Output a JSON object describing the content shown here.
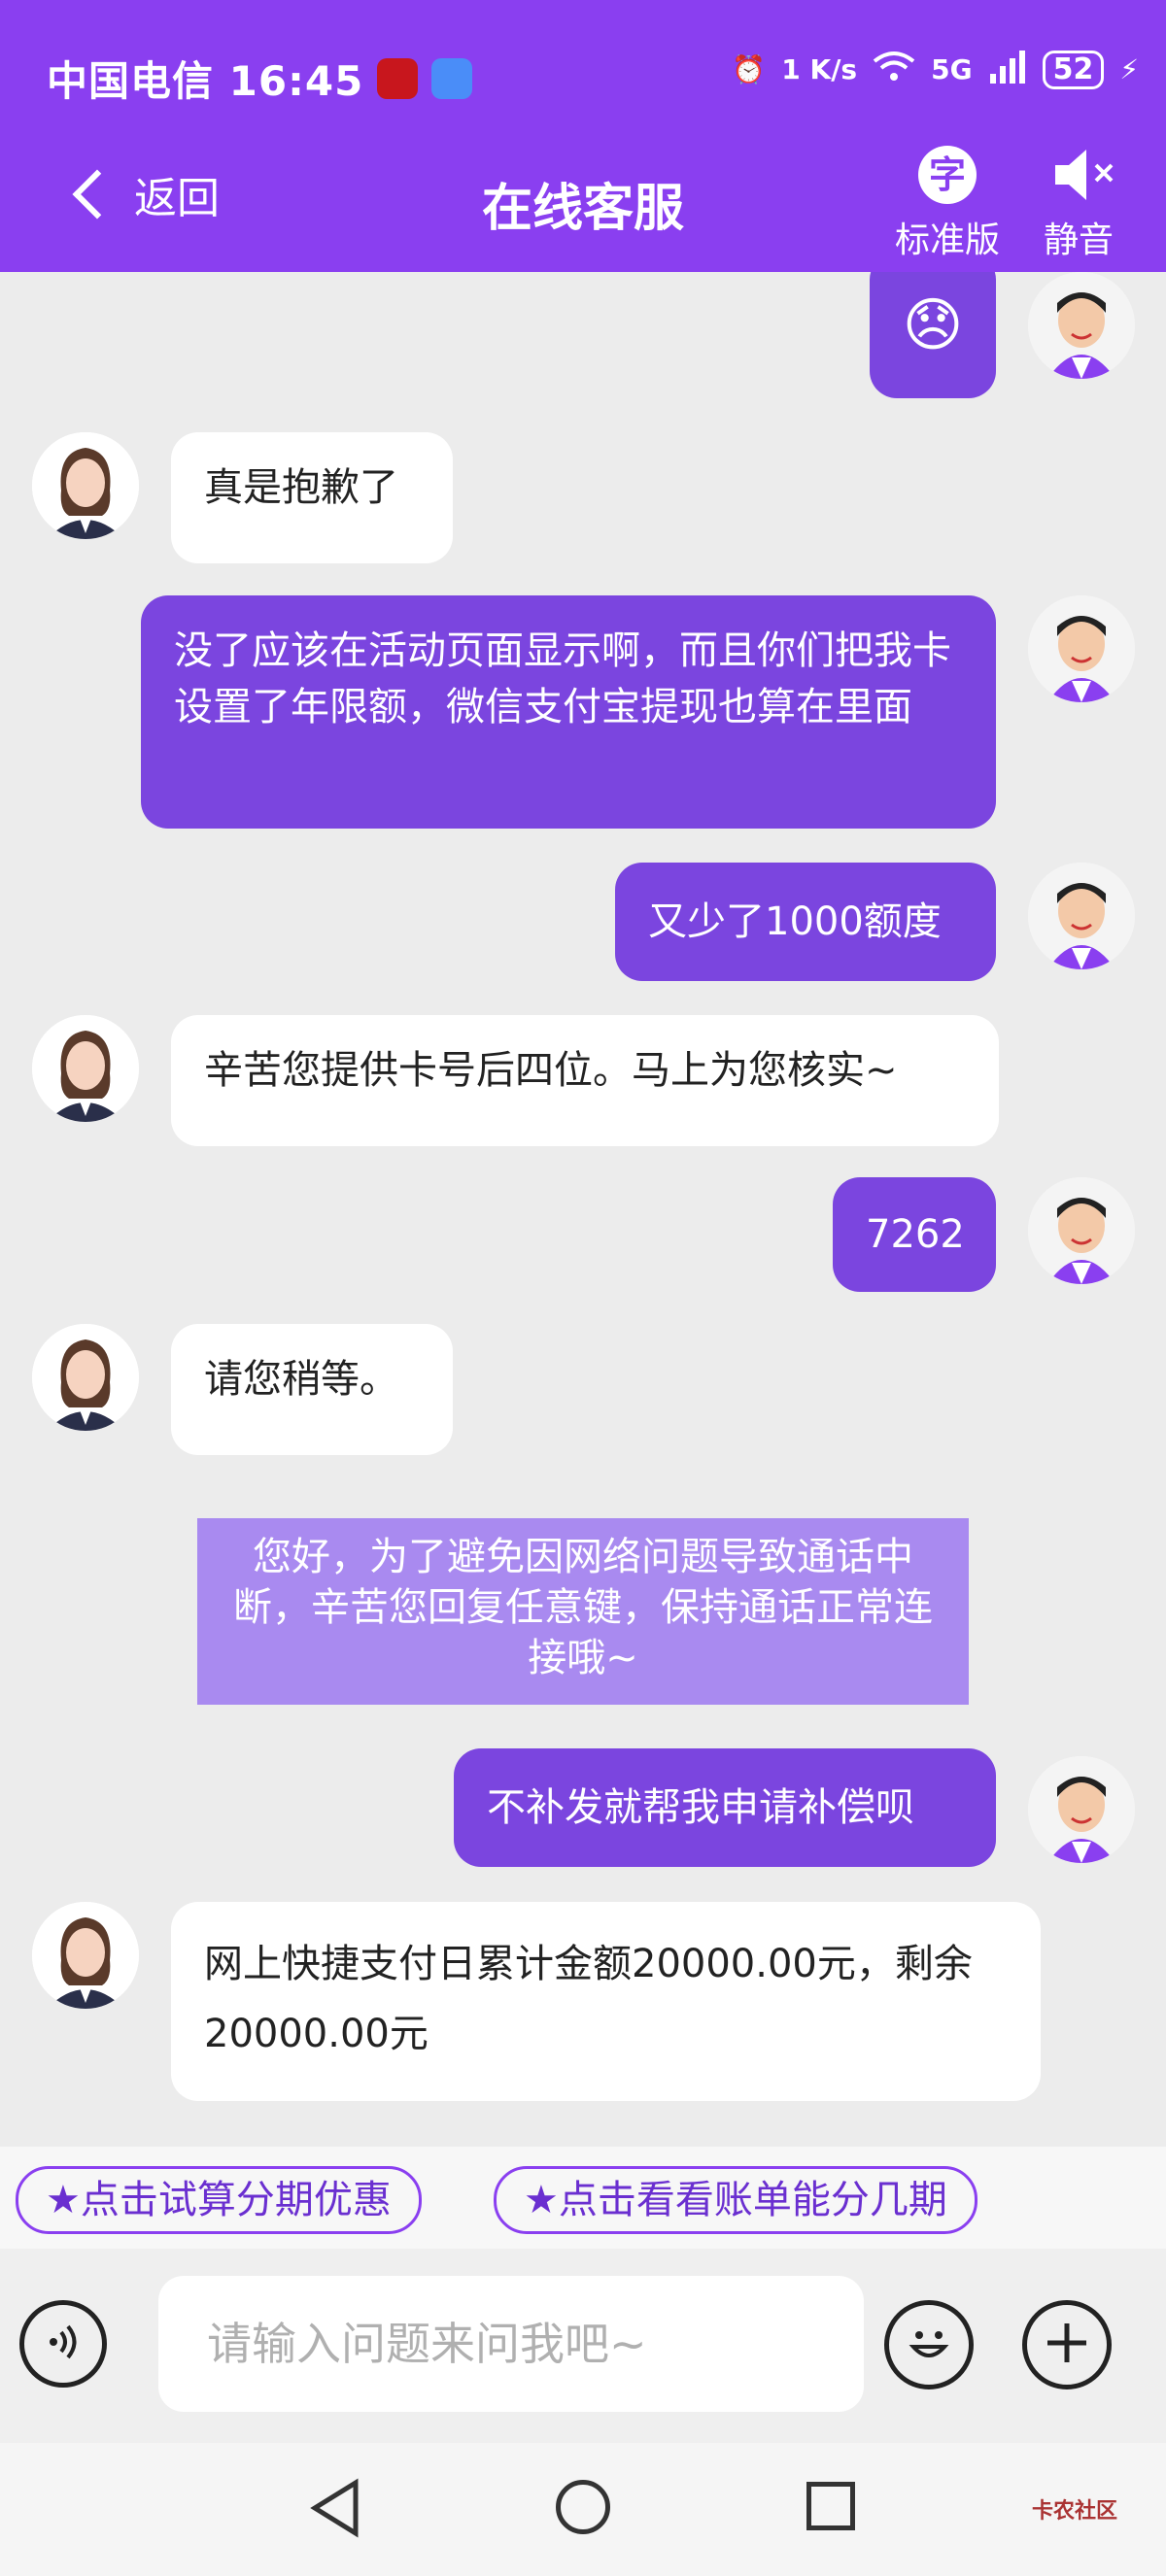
{
  "status_bar": {
    "carrier_time": "中国电信 16:45",
    "speed": "1 K/s",
    "network": "5G",
    "battery": "52"
  },
  "header": {
    "back_label": "返回",
    "title": "在线客服",
    "standard_label": "标准版",
    "standard_glyph": "字",
    "mute_label": "静音"
  },
  "messages": [
    {
      "from": "user",
      "text": "😞"
    },
    {
      "from": "agent",
      "text": "真是抱歉了"
    },
    {
      "from": "user",
      "text": "没了应该在活动页面显示啊，而且你们把我卡设置了年限额，微信支付宝提现也算在里面"
    },
    {
      "from": "user",
      "text": "又少了1000额度"
    },
    {
      "from": "agent",
      "text": "辛苦您提供卡号后四位。马上为您核实~"
    },
    {
      "from": "user",
      "text": "7262"
    },
    {
      "from": "agent",
      "text": "请您稍等。"
    },
    {
      "from": "system",
      "text": "您好，为了避免因网络问题导致通话中断，辛苦您回复任意键，保持通话正常连接哦~"
    },
    {
      "from": "user",
      "text": "不补发就帮我申请补偿呗"
    },
    {
      "from": "agent",
      "text": "网上快捷支付日累计金额20000.00元，剩余20000.00元"
    }
  ],
  "quick_actions": [
    "★点击试算分期优惠",
    "★点击看看账单能分几期"
  ],
  "input": {
    "placeholder": "请输入问题来问我吧~"
  },
  "watermark": "卡农社区",
  "colors": {
    "brand": "#8a3ff0",
    "user_bubble": "#7b45df",
    "notice": "#a98af0"
  }
}
